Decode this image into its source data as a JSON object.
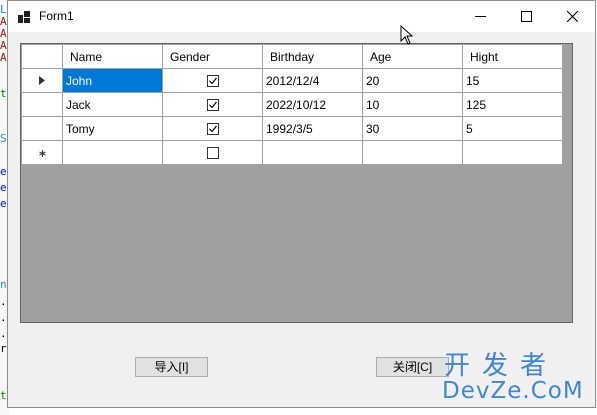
{
  "window": {
    "title": "Form1",
    "minimize_icon": "minimize-icon",
    "maximize_icon": "maximize-icon",
    "close_icon": "close-icon"
  },
  "grid": {
    "columns": [
      "Name",
      "Gender",
      "Birthday",
      "Age",
      "Hight"
    ],
    "rows": [
      {
        "name": "John",
        "gender_checked": true,
        "birthday": "2012/12/4",
        "age": "20",
        "hight": "15"
      },
      {
        "name": "Jack",
        "gender_checked": true,
        "birthday": "2022/10/12",
        "age": "10",
        "hight": "125"
      },
      {
        "name": "Tomy",
        "gender_checked": true,
        "birthday": "1992/3/5",
        "age": "30",
        "hight": "5"
      }
    ],
    "new_row": {
      "name": "",
      "gender_checked": false,
      "birthday": "",
      "age": "",
      "hight": ""
    },
    "current_row_glyph": "current-row-arrow-icon",
    "new_row_glyph": "new-row-asterisk-icon",
    "selected_cell": "row 0, Name"
  },
  "buttons": {
    "import_label": "导入[I]",
    "close_label": "关闭[C]"
  },
  "watermark": {
    "top": "开发者",
    "bottom": "DevZe.CoM"
  },
  "editor_fragments": [
    "L",
    "A",
    "A",
    "A",
    "A",
    "t",
    "S",
    "e",
    "e",
    "e",
    "n",
    ".",
    ".",
    ".",
    "r",
    "t"
  ],
  "colors": {
    "selection": "#0078d7",
    "grid_background": "#a0a0a0",
    "form_background": "#f0f0f0",
    "watermark": "#2a7bd8"
  }
}
